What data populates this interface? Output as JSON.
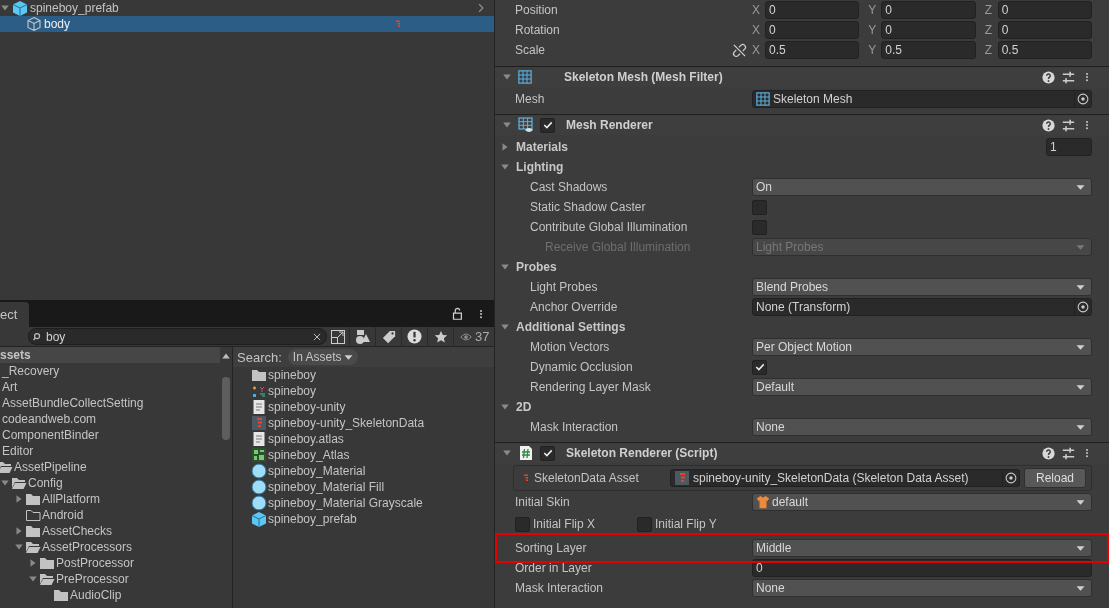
{
  "hierarchy": {
    "items": [
      {
        "label": "spineboy_prefab",
        "kind": "prefab",
        "expanded": true,
        "selected": false,
        "children": [
          {
            "label": "body",
            "kind": "object",
            "selected": true,
            "marker": true
          }
        ]
      }
    ]
  },
  "project": {
    "tab": "ect",
    "search": {
      "value": "boy"
    },
    "count": "37",
    "tree": {
      "header": "ssets",
      "items": [
        {
          "label": "_Recovery",
          "kind": "plain"
        },
        {
          "label": "Art",
          "kind": "plain"
        },
        {
          "label": "AssetBundleCollectSetting",
          "kind": "plain"
        },
        {
          "label": "codeandweb.com",
          "kind": "plain"
        },
        {
          "label": "ComponentBinder",
          "kind": "plain"
        },
        {
          "label": "Editor",
          "kind": "plain"
        },
        {
          "label": "AssetPipeline",
          "kind": "folder",
          "expanded": true,
          "children": [
            {
              "label": "Config",
              "kind": "folder",
              "expanded": true,
              "children": [
                {
                  "label": "AllPlatform",
                  "kind": "folder",
                  "expanded": false
                },
                {
                  "label": "Android",
                  "kind": "empty"
                },
                {
                  "label": "AssetChecks",
                  "kind": "folder",
                  "expanded": false
                },
                {
                  "label": "AssetProcessors",
                  "kind": "folder",
                  "expanded": true,
                  "children": [
                    {
                      "label": "PostProcessor",
                      "kind": "folder",
                      "expanded": false
                    },
                    {
                      "label": "PreProcessor",
                      "kind": "folder",
                      "expanded": true,
                      "children": [
                        {
                          "label": "AudioClip",
                          "kind": "leaf"
                        }
                      ]
                    }
                  ]
                }
              ]
            }
          ]
        }
      ]
    },
    "search_label": "Search:",
    "scope": "In Assets",
    "assets": [
      {
        "label": "spineboy",
        "kind": "folder"
      },
      {
        "label": "spineboy",
        "kind": "skeleton"
      },
      {
        "label": "spineboy-unity",
        "kind": "text"
      },
      {
        "label": "spineboy-unity_SkeletonData",
        "kind": "skeleton-data"
      },
      {
        "label": "spineboy.atlas",
        "kind": "text"
      },
      {
        "label": "spineboy_Atlas",
        "kind": "atlas"
      },
      {
        "label": "spineboy_Material",
        "kind": "material"
      },
      {
        "label": "spineboy_Material Fill",
        "kind": "material"
      },
      {
        "label": "spineboy_Material Grayscale",
        "kind": "material"
      },
      {
        "label": "spineboy_prefab",
        "kind": "prefab"
      }
    ]
  },
  "inspector": {
    "transform": [
      {
        "label": "Position",
        "fields": [
          {
            "axis": "X",
            "value": "0"
          },
          {
            "axis": "Y",
            "value": "0"
          },
          {
            "axis": "Z",
            "value": "0"
          }
        ]
      },
      {
        "label": "Rotation",
        "fields": [
          {
            "axis": "X",
            "value": "0"
          },
          {
            "axis": "Y",
            "value": "0"
          },
          {
            "axis": "Z",
            "value": "0"
          }
        ]
      },
      {
        "label": "Scale",
        "constrained": false,
        "fields": [
          {
            "axis": "X",
            "value": "0.5"
          },
          {
            "axis": "Y",
            "value": "0.5"
          },
          {
            "axis": "Z",
            "value": "0.5"
          }
        ]
      }
    ],
    "components": [
      {
        "title": "Skeleton Mesh (Mesh Filter)",
        "kind": "mesh-filter",
        "expanded": true,
        "rows": [
          {
            "kind": "mesh",
            "label": "Mesh",
            "value": "Skeleton Mesh"
          }
        ]
      },
      {
        "title": "Mesh Renderer",
        "kind": "mesh-renderer",
        "enabled": true,
        "expanded": true,
        "rows": [
          {
            "kind": "foldout",
            "label": "Materials",
            "expanded": false,
            "value": "1"
          },
          {
            "kind": "foldout",
            "label": "Lighting",
            "expanded": true,
            "children": [
              {
                "kind": "dropdown",
                "label": "Cast Shadows",
                "value": "On",
                "disabled": false
              },
              {
                "kind": "checkbox",
                "label": "Static Shadow Caster",
                "checked": false
              },
              {
                "kind": "checkbox",
                "label": "Contribute Global Illumination",
                "checked": false,
                "children": [
                  {
                    "kind": "dropdown",
                    "label": "Receive Global Illumination",
                    "value": "Light Probes",
                    "disabled": true
                  }
                ]
              }
            ]
          },
          {
            "kind": "foldout",
            "label": "Probes",
            "expanded": true,
            "children": [
              {
                "kind": "dropdown",
                "label": "Light Probes",
                "value": "Blend Probes",
                "disabled": false
              },
              {
                "kind": "object",
                "label": "Anchor Override",
                "value": "None (Transform)"
              }
            ]
          },
          {
            "kind": "foldout",
            "label": "Additional Settings",
            "expanded": true,
            "children": [
              {
                "kind": "dropdown",
                "label": "Motion Vectors",
                "value": "Per Object Motion",
                "disabled": false
              },
              {
                "kind": "checkbox",
                "label": "Dynamic Occlusion",
                "checked": true
              },
              {
                "kind": "dropdown",
                "label": "Rendering Layer Mask",
                "value": "Default",
                "disabled": false
              }
            ]
          },
          {
            "kind": "foldout",
            "label": "2D",
            "expanded": true,
            "children": [
              {
                "kind": "dropdown",
                "label": "Mask Interaction",
                "value": "None",
                "disabled": false
              }
            ]
          }
        ]
      },
      {
        "title": "Skeleton Renderer (Script)",
        "kind": "script",
        "enabled": true,
        "expanded": true,
        "rows": [
          {
            "kind": "asset",
            "label": "SkeletonData Asset",
            "value": "spineboy-unity_SkeletonData (Skeleton Data Asset)",
            "button": "Reload"
          },
          {
            "kind": "skin",
            "label": "Initial Skin",
            "value": "default",
            "disabled": false
          },
          {
            "kind": "checkbox-pair",
            "items": [
              {
                "label": "Initial Flip X",
                "checked": false
              },
              {
                "label": "Initial Flip Y",
                "checked": false
              }
            ]
          },
          {
            "kind": "dropdown",
            "label": "Sorting Layer",
            "value": "Middle",
            "disabled": false,
            "highlighted": true
          },
          {
            "kind": "number",
            "label": "Order in Layer",
            "value": "0"
          },
          {
            "kind": "dropdown",
            "label": "Mask Interaction",
            "value": "None",
            "disabled": false
          }
        ]
      }
    ]
  }
}
